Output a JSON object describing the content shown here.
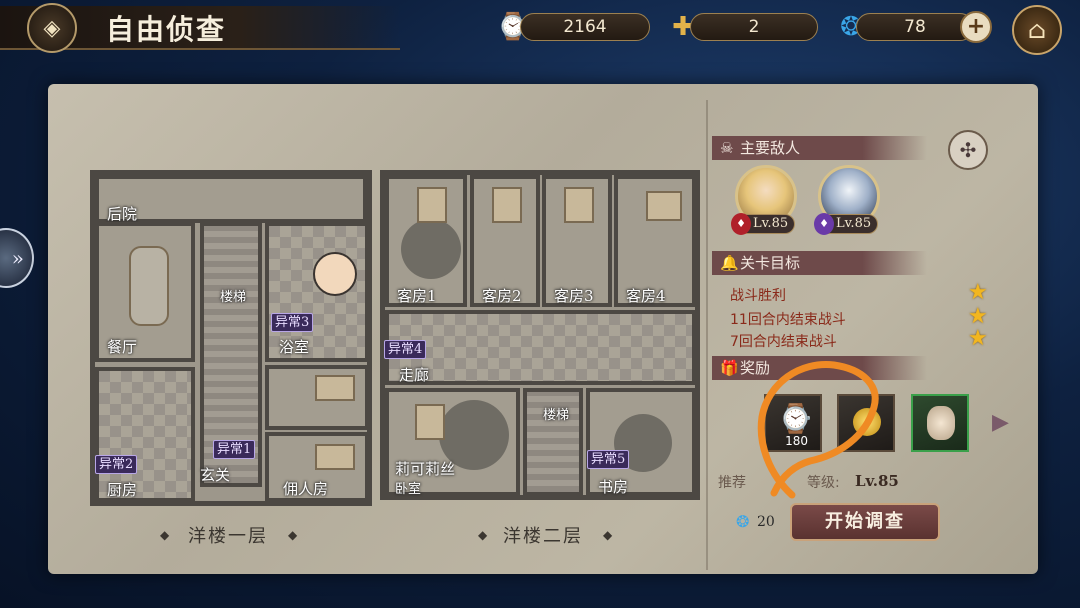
{
  "header": {
    "title": "自由侦查",
    "resources": [
      {
        "icon": "pocket-watch-icon",
        "value": "2164"
      },
      {
        "icon": "puzzle-piece-icon",
        "value": "2"
      },
      {
        "icon": "blue-flame-icon",
        "value": "78"
      }
    ],
    "plus_label": "+"
  },
  "map": {
    "floor1_label": "洋楼一层",
    "floor2_label": "洋楼二层",
    "rooms": {
      "houyuan": "后院",
      "canting": "餐厅",
      "loudi1": "楼梯",
      "yushi": "浴室",
      "chufang": "厨房",
      "xuanguan": "玄关",
      "yongrenfang": "佣人房",
      "kefang1": "客房1",
      "kefang2": "客房2",
      "kefang3": "客房3",
      "kefang4": "客房4",
      "zoulang": "走廊",
      "liklisi": "莉可莉丝",
      "woshi": "卧室",
      "loudi2": "楼梯",
      "shufang": "书房"
    },
    "anomalies": {
      "a1": "异常1",
      "a2": "异常2",
      "a3": "异常3",
      "a4": "异常4",
      "a5": "异常5"
    }
  },
  "panel": {
    "enemies_title": "主要敌人",
    "enemies": [
      {
        "name": "enemy-blonde",
        "level": "Lv.85",
        "attr_color": "#b0202a"
      },
      {
        "name": "enemy-shadow",
        "level": "Lv.85",
        "attr_color": "#6a3aa8"
      }
    ],
    "goals_title": "关卡目标",
    "goals": [
      "战斗胜利",
      "11回合内结束战斗",
      "7回合内结束战斗"
    ],
    "rewards_title_visible": "奖励",
    "rewards": [
      {
        "icon": "pocket-watch-icon",
        "count": "180"
      },
      {
        "icon": "gold-coin-icon",
        "count": ""
      },
      {
        "icon": "character-shard-icon",
        "count": ""
      }
    ],
    "recommend_prefix": "推荐",
    "recommend_suffix": "等级:",
    "recommend_level": "Lv.85",
    "cost": "20",
    "start_button": "开始调查"
  }
}
